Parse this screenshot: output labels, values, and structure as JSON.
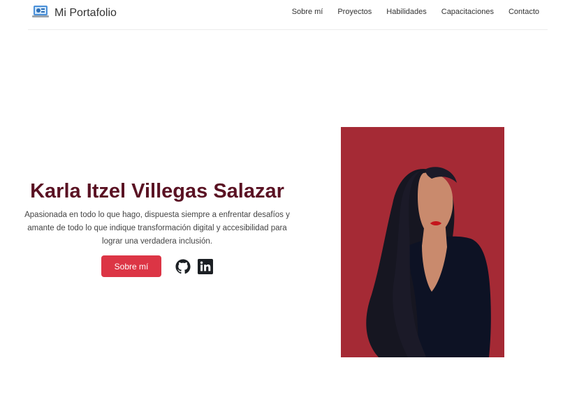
{
  "navbar": {
    "brand": "Mi Portafolio",
    "brand_icon": "laptop-icon",
    "links": [
      "Sobre mí",
      "Proyectos",
      "Habilidades",
      "Capacitaciones",
      "Contacto"
    ]
  },
  "hero": {
    "name": "Karla Itzel Villegas Salazar",
    "description": "Apasionada en todo lo que hago, dispuesta siempre a enfrentar desafíos y amante de todo lo que indique transformación digital y accesibilidad para lograr una verdadera inclusión.",
    "button_label": "Sobre mí",
    "social": [
      {
        "icon": "github-icon"
      },
      {
        "icon": "linkedin-icon"
      }
    ]
  },
  "colors": {
    "accent": "#dc3545",
    "title": "#5a1223",
    "portrait_bg": "#a52a35"
  }
}
